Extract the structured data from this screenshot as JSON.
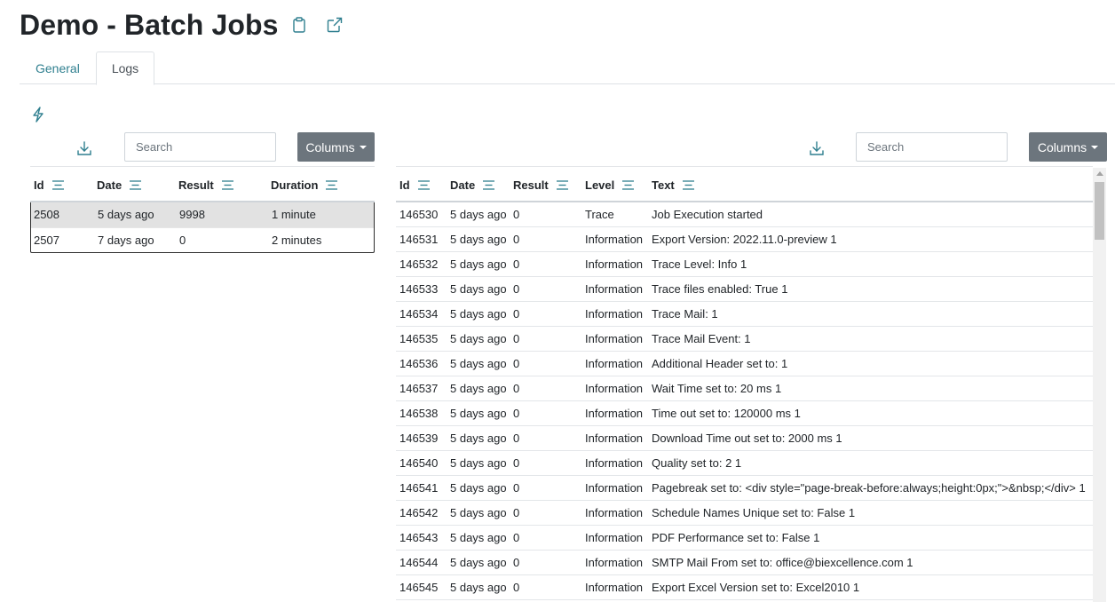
{
  "title": "Demo - Batch Jobs",
  "icons": {
    "copy": "clipboard-icon",
    "external": "external-link-icon",
    "run": "lightning-bolt-icon",
    "download": "download-icon",
    "filter": "filter-lines-icon"
  },
  "tabs": [
    {
      "label": "General",
      "active": false
    },
    {
      "label": "Logs",
      "active": true
    }
  ],
  "left": {
    "search_placeholder": "Search",
    "columns_label": "Columns",
    "headers": [
      "Id",
      "Date",
      "Result",
      "Duration"
    ],
    "rows": [
      {
        "id": "2508",
        "date": "5 days ago",
        "result": "9998",
        "duration": "1 minute",
        "selected": true
      },
      {
        "id": "2507",
        "date": "7 days ago",
        "result": "0",
        "duration": "2 minutes",
        "selected": false
      }
    ]
  },
  "right": {
    "search_placeholder": "Search",
    "columns_label": "Columns",
    "headers": [
      "Id",
      "Date",
      "Result",
      "Level",
      "Text"
    ],
    "rows": [
      {
        "id": "146530",
        "date": "5 days ago",
        "result": "0",
        "level": "Trace",
        "text": "Job Execution started"
      },
      {
        "id": "146531",
        "date": "5 days ago",
        "result": "0",
        "level": "Information",
        "text": "Export Version: 2022.11.0-preview 1"
      },
      {
        "id": "146532",
        "date": "5 days ago",
        "result": "0",
        "level": "Information",
        "text": "Trace Level: Info 1"
      },
      {
        "id": "146533",
        "date": "5 days ago",
        "result": "0",
        "level": "Information",
        "text": "Trace files enabled: True 1"
      },
      {
        "id": "146534",
        "date": "5 days ago",
        "result": "0",
        "level": "Information",
        "text": "Trace Mail: 1"
      },
      {
        "id": "146535",
        "date": "5 days ago",
        "result": "0",
        "level": "Information",
        "text": "Trace Mail Event: 1"
      },
      {
        "id": "146536",
        "date": "5 days ago",
        "result": "0",
        "level": "Information",
        "text": "Additional Header set to: 1"
      },
      {
        "id": "146537",
        "date": "5 days ago",
        "result": "0",
        "level": "Information",
        "text": "Wait Time set to: 20 ms 1"
      },
      {
        "id": "146538",
        "date": "5 days ago",
        "result": "0",
        "level": "Information",
        "text": "Time out set to: 120000 ms 1"
      },
      {
        "id": "146539",
        "date": "5 days ago",
        "result": "0",
        "level": "Information",
        "text": "Download Time out set to: 2000 ms 1"
      },
      {
        "id": "146540",
        "date": "5 days ago",
        "result": "0",
        "level": "Information",
        "text": "Quality set to: 2 1"
      },
      {
        "id": "146541",
        "date": "5 days ago",
        "result": "0",
        "level": "Information",
        "text": "Pagebreak set to: <div style=\"page-break-before:always;height:0px;\">&nbsp;</div> 1"
      },
      {
        "id": "146542",
        "date": "5 days ago",
        "result": "0",
        "level": "Information",
        "text": "Schedule Names Unique set to: False 1"
      },
      {
        "id": "146543",
        "date": "5 days ago",
        "result": "0",
        "level": "Information",
        "text": "PDF Performance set to: False 1"
      },
      {
        "id": "146544",
        "date": "5 days ago",
        "result": "0",
        "level": "Information",
        "text": "SMTP Mail From set to: office@biexcellence.com 1"
      },
      {
        "id": "146545",
        "date": "5 days ago",
        "result": "0",
        "level": "Information",
        "text": "Export Excel Version set to: Excel2010 1"
      }
    ]
  },
  "colors": {
    "accent": "#2f7f8f",
    "button": "#6c757d",
    "selected_row": "#e2e2e2"
  }
}
